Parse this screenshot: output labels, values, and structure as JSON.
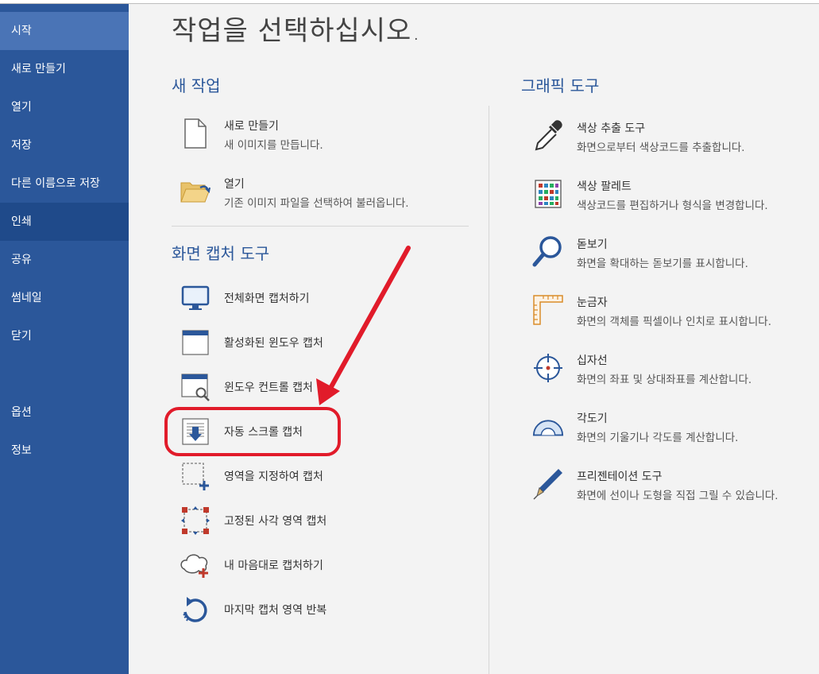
{
  "sidebar": {
    "items": [
      {
        "label": "시작"
      },
      {
        "label": "새로 만들기"
      },
      {
        "label": "열기"
      },
      {
        "label": "저장"
      },
      {
        "label": "다른 이름으로 저장"
      },
      {
        "label": "인쇄"
      },
      {
        "label": "공유"
      },
      {
        "label": "썸네일"
      },
      {
        "label": "닫기"
      },
      {
        "label": "옵션"
      },
      {
        "label": "정보"
      }
    ]
  },
  "main": {
    "title": "작업을 선택하십시오.",
    "new_task": {
      "heading": "새 작업",
      "items": [
        {
          "title": "새로 만들기",
          "desc": "새 이미지를 만듭니다.",
          "icon": "blank-page-icon"
        },
        {
          "title": "열기",
          "desc": "기존 이미지 파일을 선택하여 불러옵니다.",
          "icon": "open-folder-icon"
        }
      ]
    },
    "capture": {
      "heading": "화면 캡처 도구",
      "items": [
        {
          "title": "전체화면 캡처하기",
          "icon": "monitor-icon"
        },
        {
          "title": "활성화된 윈도우 캡처",
          "icon": "window-icon"
        },
        {
          "title": "윈도우 컨트롤 캡처",
          "icon": "window-magnifier-icon"
        },
        {
          "title": "자동 스크롤 캡처",
          "icon": "scroll-down-icon"
        },
        {
          "title": "영역을 지정하여 캡처",
          "icon": "dashed-region-icon"
        },
        {
          "title": "고정된 사각 영역 캡처",
          "icon": "fixed-rect-icon"
        },
        {
          "title": "내 마음대로 캡처하기",
          "icon": "freeform-cloud-icon"
        },
        {
          "title": "마지막 캡처 영역 반복",
          "icon": "repeat-icon"
        }
      ]
    },
    "graphic": {
      "heading": "그래픽 도구",
      "items": [
        {
          "title": "색상 추출 도구",
          "desc": "화면으로부터 색상코드를 추출합니다.",
          "icon": "eyedropper-icon"
        },
        {
          "title": "색상 팔레트",
          "desc": "색상코드를 편집하거나 형식을 변경합니다.",
          "icon": "palette-grid-icon"
        },
        {
          "title": "돋보기",
          "desc": "화면을 확대하는 돋보기를 표시합니다.",
          "icon": "magnifier-icon"
        },
        {
          "title": "눈금자",
          "desc": "화면의 객체를 픽셀이나 인치로 표시합니다.",
          "icon": "ruler-icon"
        },
        {
          "title": "십자선",
          "desc": "화면의 좌표 및 상대좌표를 계산합니다.",
          "icon": "crosshair-icon"
        },
        {
          "title": "각도기",
          "desc": "화면의 기울기나 각도를 계산합니다.",
          "icon": "protractor-icon"
        },
        {
          "title": "프리젠테이션 도구",
          "desc": "화면에 선이나 도형을 직접 그릴 수 있습니다.",
          "icon": "pen-icon"
        }
      ]
    }
  },
  "colors": {
    "sidebar_bg": "#2b579a",
    "accent": "#2b579a",
    "annotation_red": "#e11b2a"
  }
}
